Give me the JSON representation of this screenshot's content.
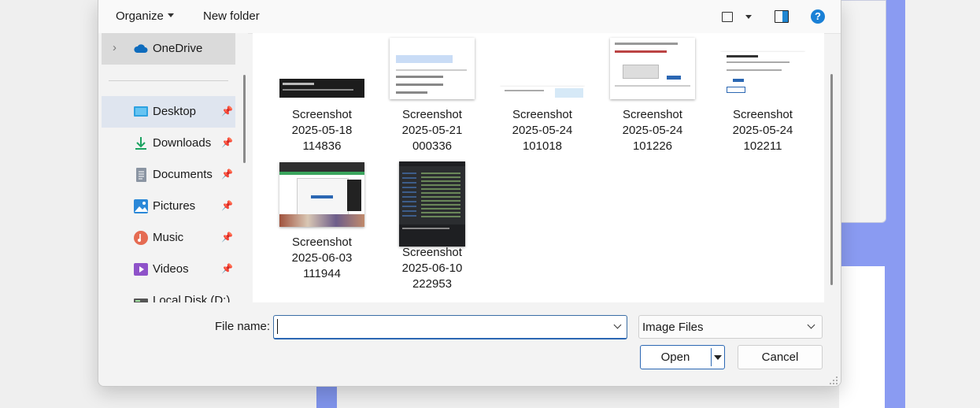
{
  "toolbar": {
    "organize_label": "Organize",
    "new_folder_label": "New folder",
    "help_label": "?"
  },
  "nav": {
    "items": [
      {
        "label": "OneDrive",
        "icon": "cloud-icon",
        "pinned": false
      },
      {
        "label": "Desktop",
        "icon": "desktop-icon",
        "pinned": true
      },
      {
        "label": "Downloads",
        "icon": "download-icon",
        "pinned": true
      },
      {
        "label": "Documents",
        "icon": "document-icon",
        "pinned": true
      },
      {
        "label": "Pictures",
        "icon": "picture-icon",
        "pinned": true
      },
      {
        "label": "Music",
        "icon": "music-icon",
        "pinned": true
      },
      {
        "label": "Videos",
        "icon": "video-icon",
        "pinned": true
      },
      {
        "label": "Local Disk (D:)",
        "icon": "drive-icon",
        "pinned": false
      }
    ]
  },
  "files": [
    {
      "line1": "Screenshot",
      "line2": "2025-05-18",
      "line3": "114836"
    },
    {
      "line1": "Screenshot",
      "line2": "2025-05-21",
      "line3": "000336"
    },
    {
      "line1": "Screenshot",
      "line2": "2025-05-24",
      "line3": "101018"
    },
    {
      "line1": "Screenshot",
      "line2": "2025-05-24",
      "line3": "101226"
    },
    {
      "line1": "Screenshot",
      "line2": "2025-05-24",
      "line3": "102211"
    },
    {
      "line1": "Screenshot",
      "line2": "2025-06-03",
      "line3": "111944"
    },
    {
      "line1": "Screenshot",
      "line2": "2025-06-10",
      "line3": "222953"
    }
  ],
  "bottom": {
    "file_name_label": "File name:",
    "file_name_value": "",
    "file_type_value": "Image Files",
    "open_label": "Open",
    "cancel_label": "Cancel"
  },
  "colors": {
    "accent": "#2b67b3",
    "selection": "#dfe5ef",
    "background_accent": "#8a9bf2"
  }
}
